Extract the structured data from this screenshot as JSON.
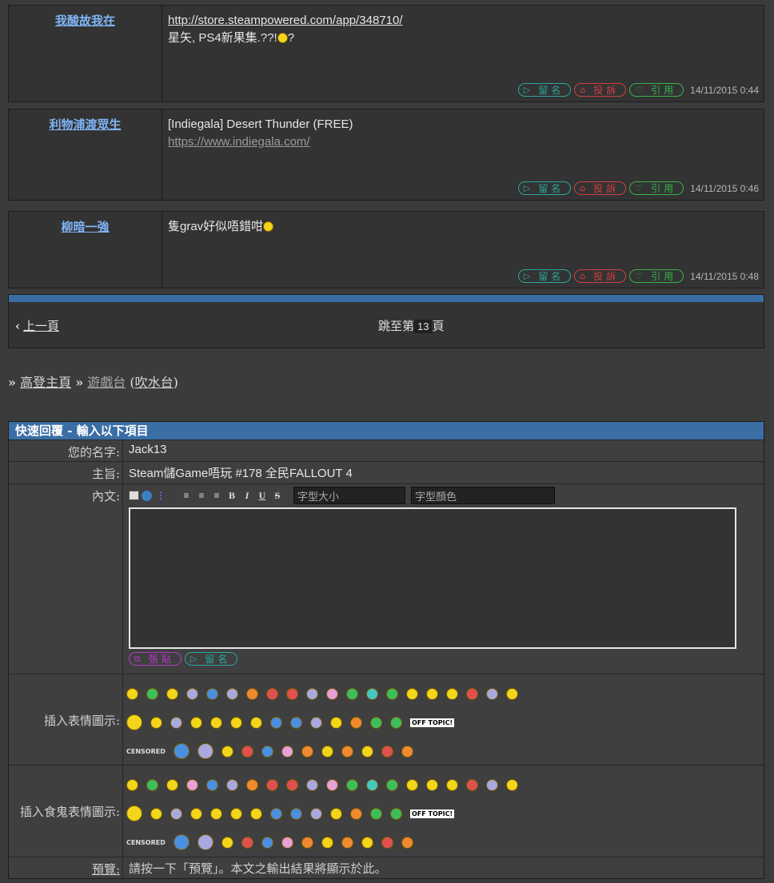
{
  "posts": [
    {
      "author": "我酸故我在",
      "lines": [
        "http://store.steampowered.com/app/348710/",
        "星矢, PS4新果集.??!",
        "?"
      ],
      "timestamp": "14/11/2015 0:44"
    },
    {
      "author": "利物浦渡眾生",
      "lines": [
        "[Indiegala] Desert Thunder (FREE)",
        "https://www.indiegala.com/"
      ],
      "timestamp": "14/11/2015 0:46"
    },
    {
      "author": "柳暗一強",
      "lines": [
        "隻grav好似唔錯咁"
      ],
      "timestamp": "14/11/2015 0:48"
    }
  ],
  "actions": {
    "leave": "留名",
    "report": "投訴",
    "quote": "引用"
  },
  "pager": {
    "prev": "上一頁",
    "jump_prefix": "跳至第",
    "page": "13",
    "jump_suffix": "頁"
  },
  "breadcrumb": {
    "sep": "»",
    "home": "高登主頁",
    "board": "遊戲台",
    "sub": "吹水台"
  },
  "quick_reply": {
    "title": "快速回覆 - 輸入以下項目",
    "name_label": "您的名字:",
    "name_value": "Jack13",
    "subject_label": "主旨:",
    "subject_value": "Steam儲Game唔玩 #178 全民FALLOUT 4",
    "content_label": "內文:",
    "font_size": "字型大小",
    "font_color": "字型顏色",
    "post_button": "張貼",
    "leave_button": "留名",
    "emoticons_label": "插入表情圖示:",
    "ghost_emoticons_label": "插入食鬼表情圖示:",
    "censored": "CENSORED",
    "offtopic": "OFF TOPIC!",
    "preview_label": "預覽:",
    "preview_text": "請按一下「預覽」。本文之輸出結果將顯示於此。"
  },
  "colors": {
    "accent": "#3a6ea5",
    "author": "#7fb4f5",
    "cyan": "#2aa6a0",
    "red": "#d23f3f",
    "green": "#34b34a"
  }
}
